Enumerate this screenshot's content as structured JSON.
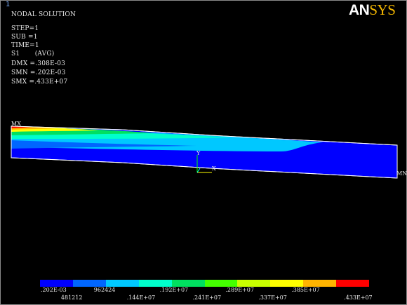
{
  "window_number": "1",
  "logo": {
    "part1": "AN",
    "part2": "SYS"
  },
  "info": {
    "title": "NODAL SOLUTION",
    "step": "STEP=1",
    "sub": "SUB =1",
    "time": "TIME=1",
    "s1": "S1       (AVG)",
    "dmx": "DMX =.308E-03",
    "smn": "SMN =.202E-03",
    "smx": "SMX =.433E+07"
  },
  "markers": {
    "mx": "MX",
    "mn": "MN",
    "axis_y": "Y",
    "axis_x": "X"
  },
  "legend": {
    "colors": [
      "#0000ff",
      "#0066ff",
      "#00c8ff",
      "#00ffcc",
      "#00e060",
      "#44ff00",
      "#c8ff00",
      "#ffff00",
      "#ffb400",
      "#ff0000"
    ],
    "top_labels": [
      ".202E-03",
      "962424",
      ".192E+07",
      ".289E+07",
      ".385E+07"
    ],
    "bottom_labels": [
      "481212",
      ".144E+07",
      ".241E+07",
      ".337E+07",
      ".433E+07"
    ]
  }
}
